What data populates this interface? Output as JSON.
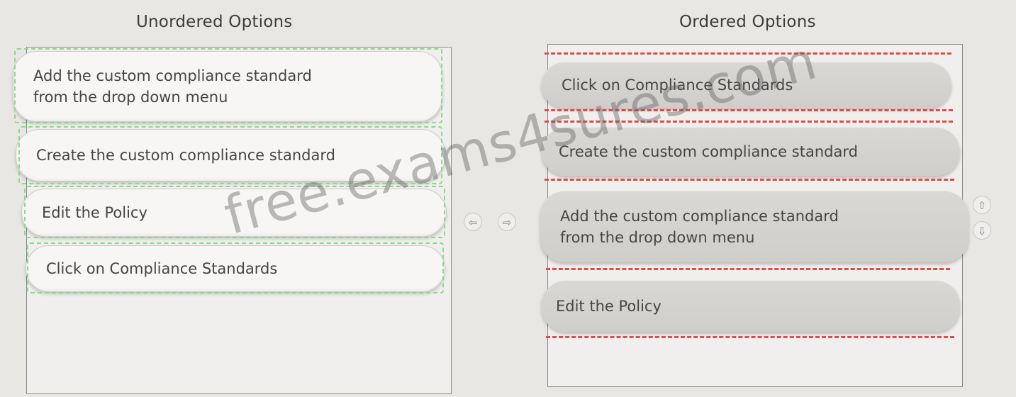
{
  "left_panel": {
    "heading": "Unordered Options",
    "items": [
      {
        "text": "Add the custom compliance standard\nfrom the drop down menu"
      },
      {
        "text": "Create the custom compliance standard"
      },
      {
        "text": "Edit the Policy"
      },
      {
        "text": "Click on Compliance Standards"
      }
    ]
  },
  "right_panel": {
    "heading": "Ordered Options",
    "items": [
      {
        "text": "Click on Compliance Standards"
      },
      {
        "text": "Create the custom compliance standard"
      },
      {
        "text": "Add the custom compliance standard\nfrom the drop down menu"
      },
      {
        "text": "Edit the Policy"
      }
    ]
  },
  "controls": {
    "move_left": "⇦",
    "move_right": "⇨",
    "move_up": "⇧",
    "move_down": "⇩"
  },
  "watermark": "free.exams4sures.com"
}
